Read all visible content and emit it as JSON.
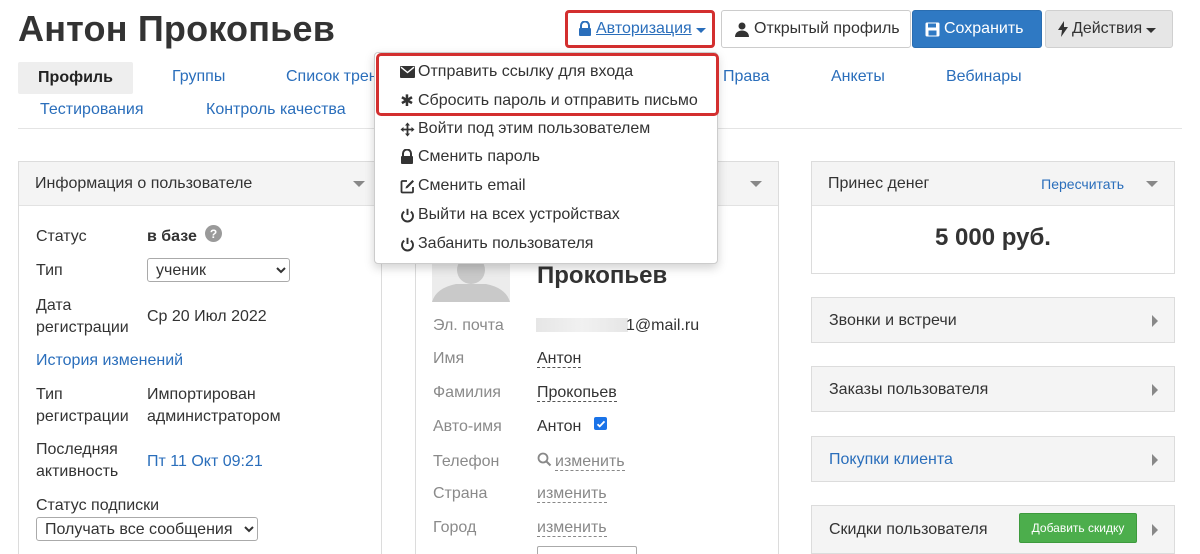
{
  "header": {
    "title": "Антон Прокопьев",
    "auth_label": "Авторизация",
    "open_profile_label": "Открытый профиль",
    "save_label": "Сохранить",
    "actions_label": "Действия"
  },
  "tabs": [
    {
      "label": "Профиль",
      "active": true
    },
    {
      "label": "Группы"
    },
    {
      "label": "Список трен"
    },
    {
      "label": "Права"
    },
    {
      "label": "Анкеты"
    },
    {
      "label": "Вебинары"
    },
    {
      "label": "Тестирования"
    },
    {
      "label": "Контроль качества"
    }
  ],
  "auth_menu": {
    "items": [
      {
        "label": "Отправить ссылку для входа",
        "icon": "envelope-icon"
      },
      {
        "label": "Сбросить пароль и отправить письмо",
        "icon": "asterisk-icon"
      },
      {
        "label": "Войти под этим пользователем",
        "icon": "move-icon"
      },
      {
        "label": "Сменить пароль",
        "icon": "lock-icon"
      },
      {
        "label": "Сменить email",
        "icon": "edit-icon"
      },
      {
        "label": "Выйти на всех устройствах",
        "icon": "power-icon"
      },
      {
        "label": "Забанить пользователя",
        "icon": "power-icon"
      }
    ]
  },
  "user_info": {
    "title": "Информация о пользователе",
    "status_label": "Статус",
    "status_value": "в базе",
    "type_label": "Тип",
    "type_value": "ученик",
    "reg_date_label": "Дата регистрации",
    "reg_date_value": "Ср 20 Июл 2022",
    "history_link": "История изменений",
    "reg_type_label": "Тип регистрации",
    "reg_type_value": "Импортирован администратором",
    "last_activity_label": "Последняя активность",
    "last_activity_value": "Пт 11 Окт 09:21",
    "subscription_label": "Статус подписки",
    "subscription_value": "Получать все сообщения"
  },
  "profile_card": {
    "surname_heading": "Прокопьев",
    "email_label": "Эл. почта",
    "email_value": "1@mail.ru",
    "name_label": "Имя",
    "name_value": "Антон",
    "lastname_label": "Фамилия",
    "lastname_value": "Прокопьев",
    "autoname_label": "Авто-имя",
    "autoname_value": "Антон",
    "phone_label": "Телефон",
    "change_label": "изменить",
    "country_label": "Страна",
    "city_label": "Город"
  },
  "money_panel": {
    "title": "Принес денег",
    "recalc_link": "Пересчитать",
    "amount": "5 000 руб."
  },
  "side_panels": {
    "calls": "Звонки и встречи",
    "orders": "Заказы пользователя",
    "purchases": "Покупки клиента",
    "discounts": "Скидки пользователя",
    "add_discount": "Добавить скидку"
  },
  "colors": {
    "accent_link": "#2a6ebb",
    "primary_button": "#2f79c3",
    "highlight": "#d32f2f",
    "success_button": "#4cae4c"
  }
}
